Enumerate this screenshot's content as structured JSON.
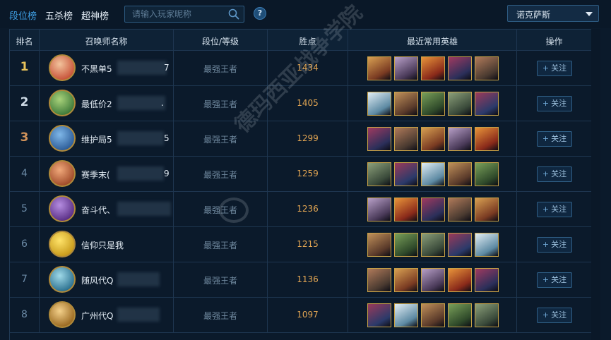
{
  "tabs": [
    {
      "label": "段位榜",
      "active": true
    },
    {
      "label": "五杀榜",
      "active": false
    },
    {
      "label": "超神榜",
      "active": false
    }
  ],
  "search": {
    "placeholder": "请输入玩家昵称",
    "value": ""
  },
  "help": {
    "label": "?"
  },
  "server": {
    "selected": "诺克萨斯"
  },
  "table": {
    "headers": {
      "rank": "排名",
      "name": "召唤师名称",
      "tier": "段位/等级",
      "lp": "胜点",
      "heroes": "最近常用英雄",
      "op": "操作"
    },
    "follow_label": "关注",
    "rows": [
      {
        "rank": "1",
        "name": "不黑单5",
        "name_tail": "7",
        "tier": "最强王者",
        "lp": "1434"
      },
      {
        "rank": "2",
        "name": "最低价2",
        "name_tail": ".",
        "tier": "最强王者",
        "lp": "1405"
      },
      {
        "rank": "3",
        "name": "维护局5",
        "name_tail": "5",
        "tier": "最强王者",
        "lp": "1299"
      },
      {
        "rank": "4",
        "name": "赛季末(",
        "name_tail": "9",
        "tier": "最强王者",
        "lp": "1259"
      },
      {
        "rank": "5",
        "name": "奋斗代、",
        "name_tail": "",
        "tier": "最强王者",
        "lp": "1236"
      },
      {
        "rank": "6",
        "name": "信仰只是我",
        "name_tail": "",
        "tier": "最强王者",
        "lp": "1215"
      },
      {
        "rank": "7",
        "name": "随风代Q",
        "name_tail": "",
        "tier": "最强王者",
        "lp": "1136"
      },
      {
        "rank": "8",
        "name": "广州代Q",
        "name_tail": "",
        "tier": "最强王者",
        "lp": "1097"
      }
    ]
  },
  "watermark": {
    "text": "德玛西亚战争学院"
  },
  "colors": {
    "accent": "#3fa1e6",
    "lp": "#e3a653",
    "gold": "#e8c25a",
    "silver": "#cfdbe6",
    "bronze": "#d2935a"
  }
}
